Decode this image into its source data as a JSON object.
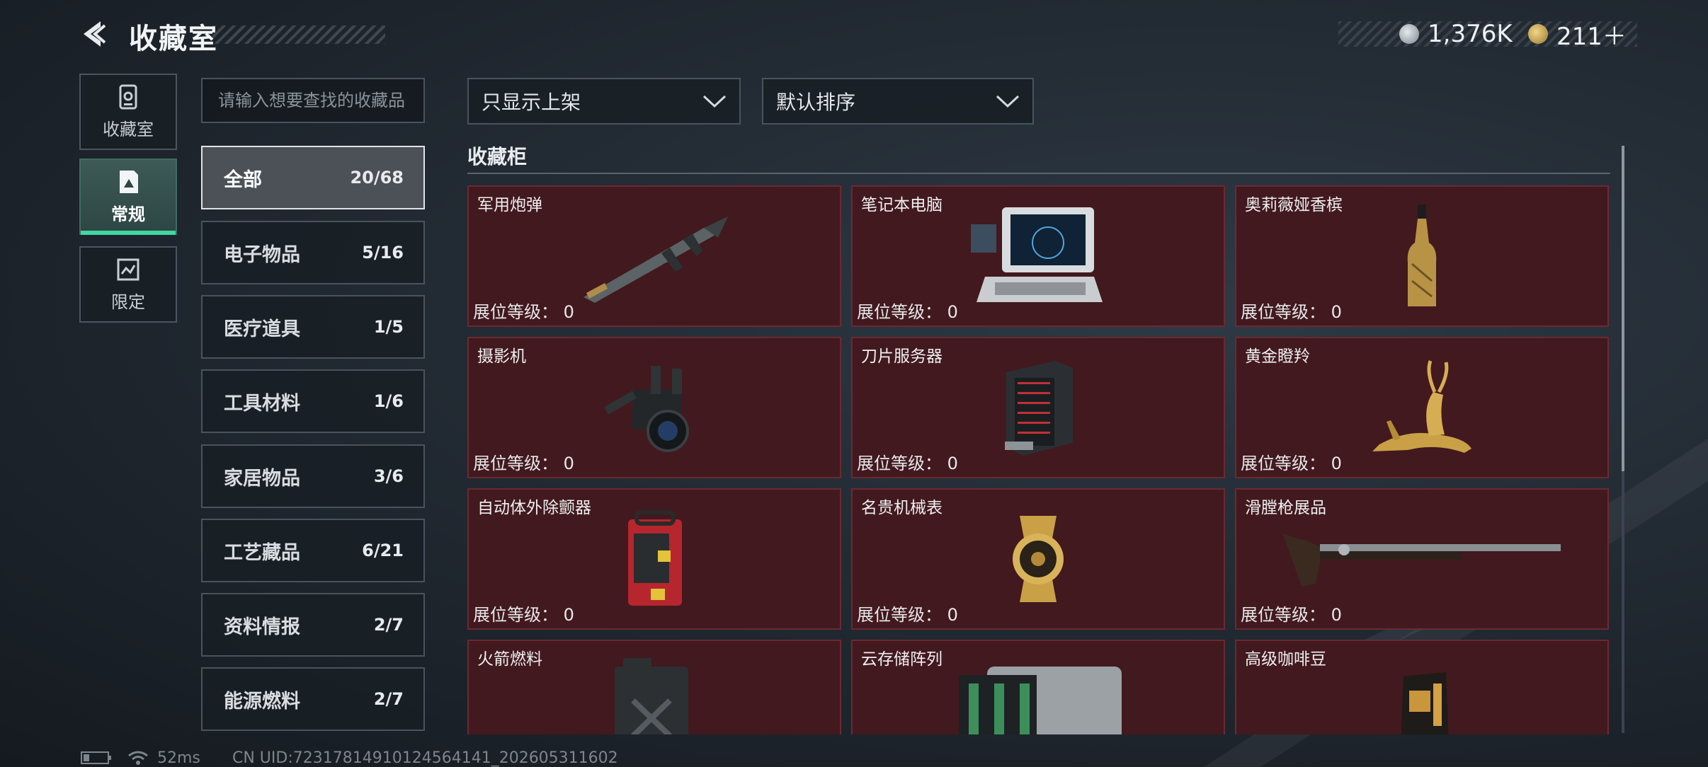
{
  "header": {
    "title": "收藏室",
    "currency": [
      {
        "icon": "silver-coin-icon",
        "value": "1,376K"
      },
      {
        "icon": "gold-coin-icon",
        "value": "211＋"
      }
    ]
  },
  "rail": [
    {
      "label": "收藏室",
      "icon": "collection-room-icon",
      "active": false
    },
    {
      "label": "常规",
      "icon": "regular-icon",
      "active": true
    },
    {
      "label": "限定",
      "icon": "limited-icon",
      "active": false
    }
  ],
  "search": {
    "placeholder": "请输入想要查找的收藏品"
  },
  "categories": [
    {
      "label": "全部",
      "count": "20/68",
      "active": true
    },
    {
      "label": "电子物品",
      "count": "5/16"
    },
    {
      "label": "医疗道具",
      "count": "1/5"
    },
    {
      "label": "工具材料",
      "count": "1/6"
    },
    {
      "label": "家居物品",
      "count": "3/6"
    },
    {
      "label": "工艺藏品",
      "count": "6/21"
    },
    {
      "label": "资料情报",
      "count": "2/7"
    },
    {
      "label": "能源燃料",
      "count": "2/7"
    }
  ],
  "filters": {
    "show": "只显示上架",
    "sort": "默认排序"
  },
  "section_title": "收藏柜",
  "display_level_label": "展位等级：",
  "items": [
    {
      "name": "军用炮弹",
      "level": "0",
      "icon": "missile-icon"
    },
    {
      "name": "笔记本电脑",
      "level": "0",
      "icon": "laptop-icon"
    },
    {
      "name": "奥莉薇娅香槟",
      "level": "0",
      "icon": "champagne-icon"
    },
    {
      "name": "摄影机",
      "level": "0",
      "icon": "camera-icon"
    },
    {
      "name": "刀片服务器",
      "level": "0",
      "icon": "server-icon"
    },
    {
      "name": "黄金瞪羚",
      "level": "0",
      "icon": "gazelle-icon"
    },
    {
      "name": "自动体外除颤器",
      "level": "0",
      "icon": "defibrillator-icon"
    },
    {
      "name": "名贵机械表",
      "level": "0",
      "icon": "watch-icon"
    },
    {
      "name": "滑膛枪展品",
      "level": "0",
      "icon": "musket-icon"
    },
    {
      "name": "火箭燃料",
      "level": "",
      "icon": "fuel-can-icon"
    },
    {
      "name": "云存储阵列",
      "level": "",
      "icon": "storage-array-icon"
    },
    {
      "name": "高级咖啡豆",
      "level": "",
      "icon": "coffee-bag-icon"
    }
  ],
  "status": {
    "ping": "52ms",
    "uid": "CN UID:7231781491012456414​1_202605311602"
  }
}
